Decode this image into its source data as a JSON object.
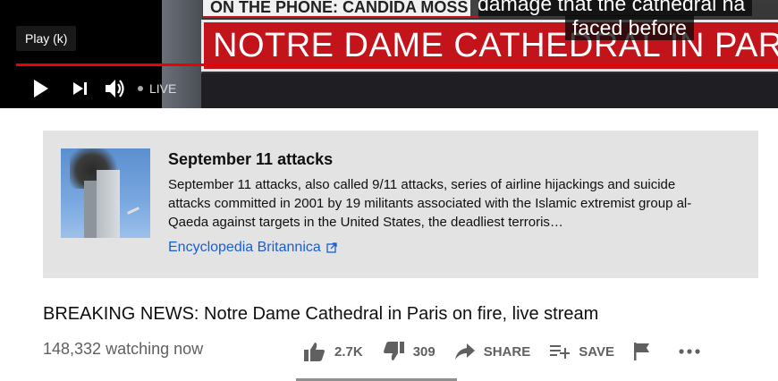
{
  "player": {
    "chyron_top": "ON THE PHONE: CANDIDA MOSS",
    "chyron_main": "NOTRE DAME CATHEDRAL IN PARIS",
    "caption_line1": "damage that the cathedral ha",
    "caption_line2": "faced before",
    "tooltip": "Play (k)",
    "live_label": "LIVE",
    "colors": {
      "progress": "#ee0000",
      "chyron_red": "#c4141b"
    }
  },
  "info_panel": {
    "title": "September 11 attacks",
    "description": "September 11 attacks, also called 9/11 attacks, series of airline hijackings and suicide attacks committed in 2001 by 19 militants associated with the Islamic extremist group al-Qaeda against targets in the United States, the deadliest terroris…",
    "source_link": "Encyclopedia Britannica",
    "image_icon": "twin-towers-thumbnail"
  },
  "video": {
    "title": "BREAKING NEWS: Notre Dame Cathedral in Paris on fire, live stream",
    "watching": "148,332 watching now"
  },
  "actions": {
    "like_count": "2.7K",
    "dislike_count": "309",
    "share_label": "SHARE",
    "save_label": "SAVE"
  }
}
